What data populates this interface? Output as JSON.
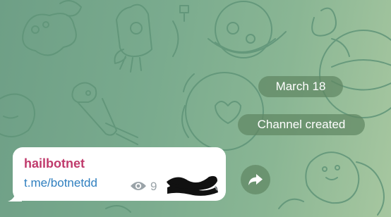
{
  "chat": {
    "date_separator": "March 18",
    "service_message": "Channel created"
  },
  "message": {
    "sender": "hailbotnet",
    "link": "t.me/botnetdd",
    "views": "9",
    "views_icon": "eye-icon"
  },
  "actions": {
    "share_icon": "share-arrow-icon"
  },
  "colors": {
    "background": "#7aab8e",
    "pill": "#5f8762",
    "sender": "#c03b6c",
    "link": "#2f7fbf",
    "meta": "#9aa3a8"
  }
}
